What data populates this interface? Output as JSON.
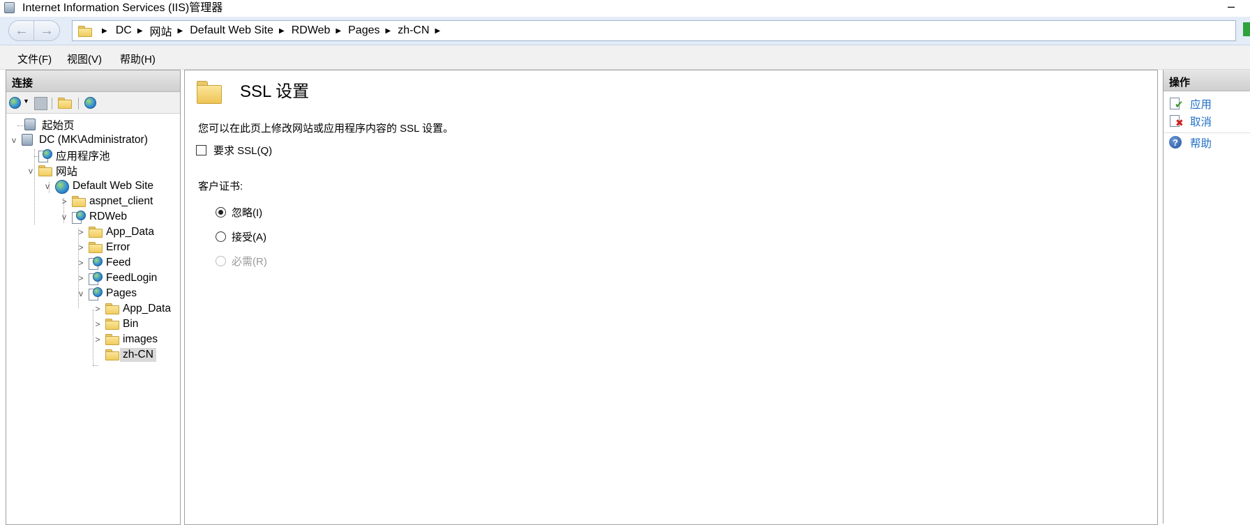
{
  "window": {
    "title": "Internet Information Services (IIS)管理器",
    "minimize": "–"
  },
  "address": {
    "crumbs": [
      "DC",
      "网站",
      "Default Web Site",
      "RDWeb",
      "Pages",
      "zh-CN"
    ]
  },
  "menu": [
    "文件(F)",
    "视图(V)",
    "帮助(H)"
  ],
  "connections": {
    "header": "连接",
    "tree": [
      {
        "label": "起始页",
        "icon": "start-page-icon",
        "level": 0,
        "expander": ""
      },
      {
        "label": "DC (MK\\Administrator)",
        "icon": "server-icon",
        "level": 0,
        "expander": "v"
      },
      {
        "label": "应用程序池",
        "icon": "app-pool-icon",
        "level": 1,
        "expander": ""
      },
      {
        "label": "网站",
        "icon": "sites-folder-icon",
        "level": 1,
        "expander": "v"
      },
      {
        "label": "Default Web Site",
        "icon": "globe-icon",
        "level": 2,
        "expander": "v"
      },
      {
        "label": "aspnet_client",
        "icon": "folder-icon",
        "level": 3,
        "expander": ">"
      },
      {
        "label": "RDWeb",
        "icon": "application-icon",
        "level": 3,
        "expander": "v"
      },
      {
        "label": "App_Data",
        "icon": "folder-icon",
        "level": 4,
        "expander": ">"
      },
      {
        "label": "Error",
        "icon": "folder-icon",
        "level": 4,
        "expander": ">"
      },
      {
        "label": "Feed",
        "icon": "application-icon",
        "level": 4,
        "expander": ">"
      },
      {
        "label": "FeedLogin",
        "icon": "application-icon",
        "level": 4,
        "expander": ">"
      },
      {
        "label": "Pages",
        "icon": "application-icon",
        "level": 4,
        "expander": "v"
      },
      {
        "label": "App_Data",
        "icon": "folder-icon",
        "level": 5,
        "expander": ">"
      },
      {
        "label": "Bin",
        "icon": "folder-icon",
        "level": 5,
        "expander": ">"
      },
      {
        "label": "images",
        "icon": "folder-icon",
        "level": 5,
        "expander": ">"
      },
      {
        "label": "zh-CN",
        "icon": "folder-icon",
        "level": 5,
        "expander": "",
        "selected": true
      }
    ]
  },
  "feature": {
    "title": "SSL 设置",
    "description": "您可以在此页上修改网站或应用程序内容的 SSL 设置。",
    "require_ssl_label": "要求 SSL(Q)",
    "require_ssl_checked": false,
    "client_cert_label": "客户证书:",
    "options": [
      {
        "label": "忽略(I)",
        "selected": true,
        "disabled": false
      },
      {
        "label": "接受(A)",
        "selected": false,
        "disabled": false
      },
      {
        "label": "必需(R)",
        "selected": false,
        "disabled": true
      }
    ]
  },
  "actions": {
    "header": "操作",
    "apply": "应用",
    "cancel": "取消",
    "help": "帮助"
  }
}
